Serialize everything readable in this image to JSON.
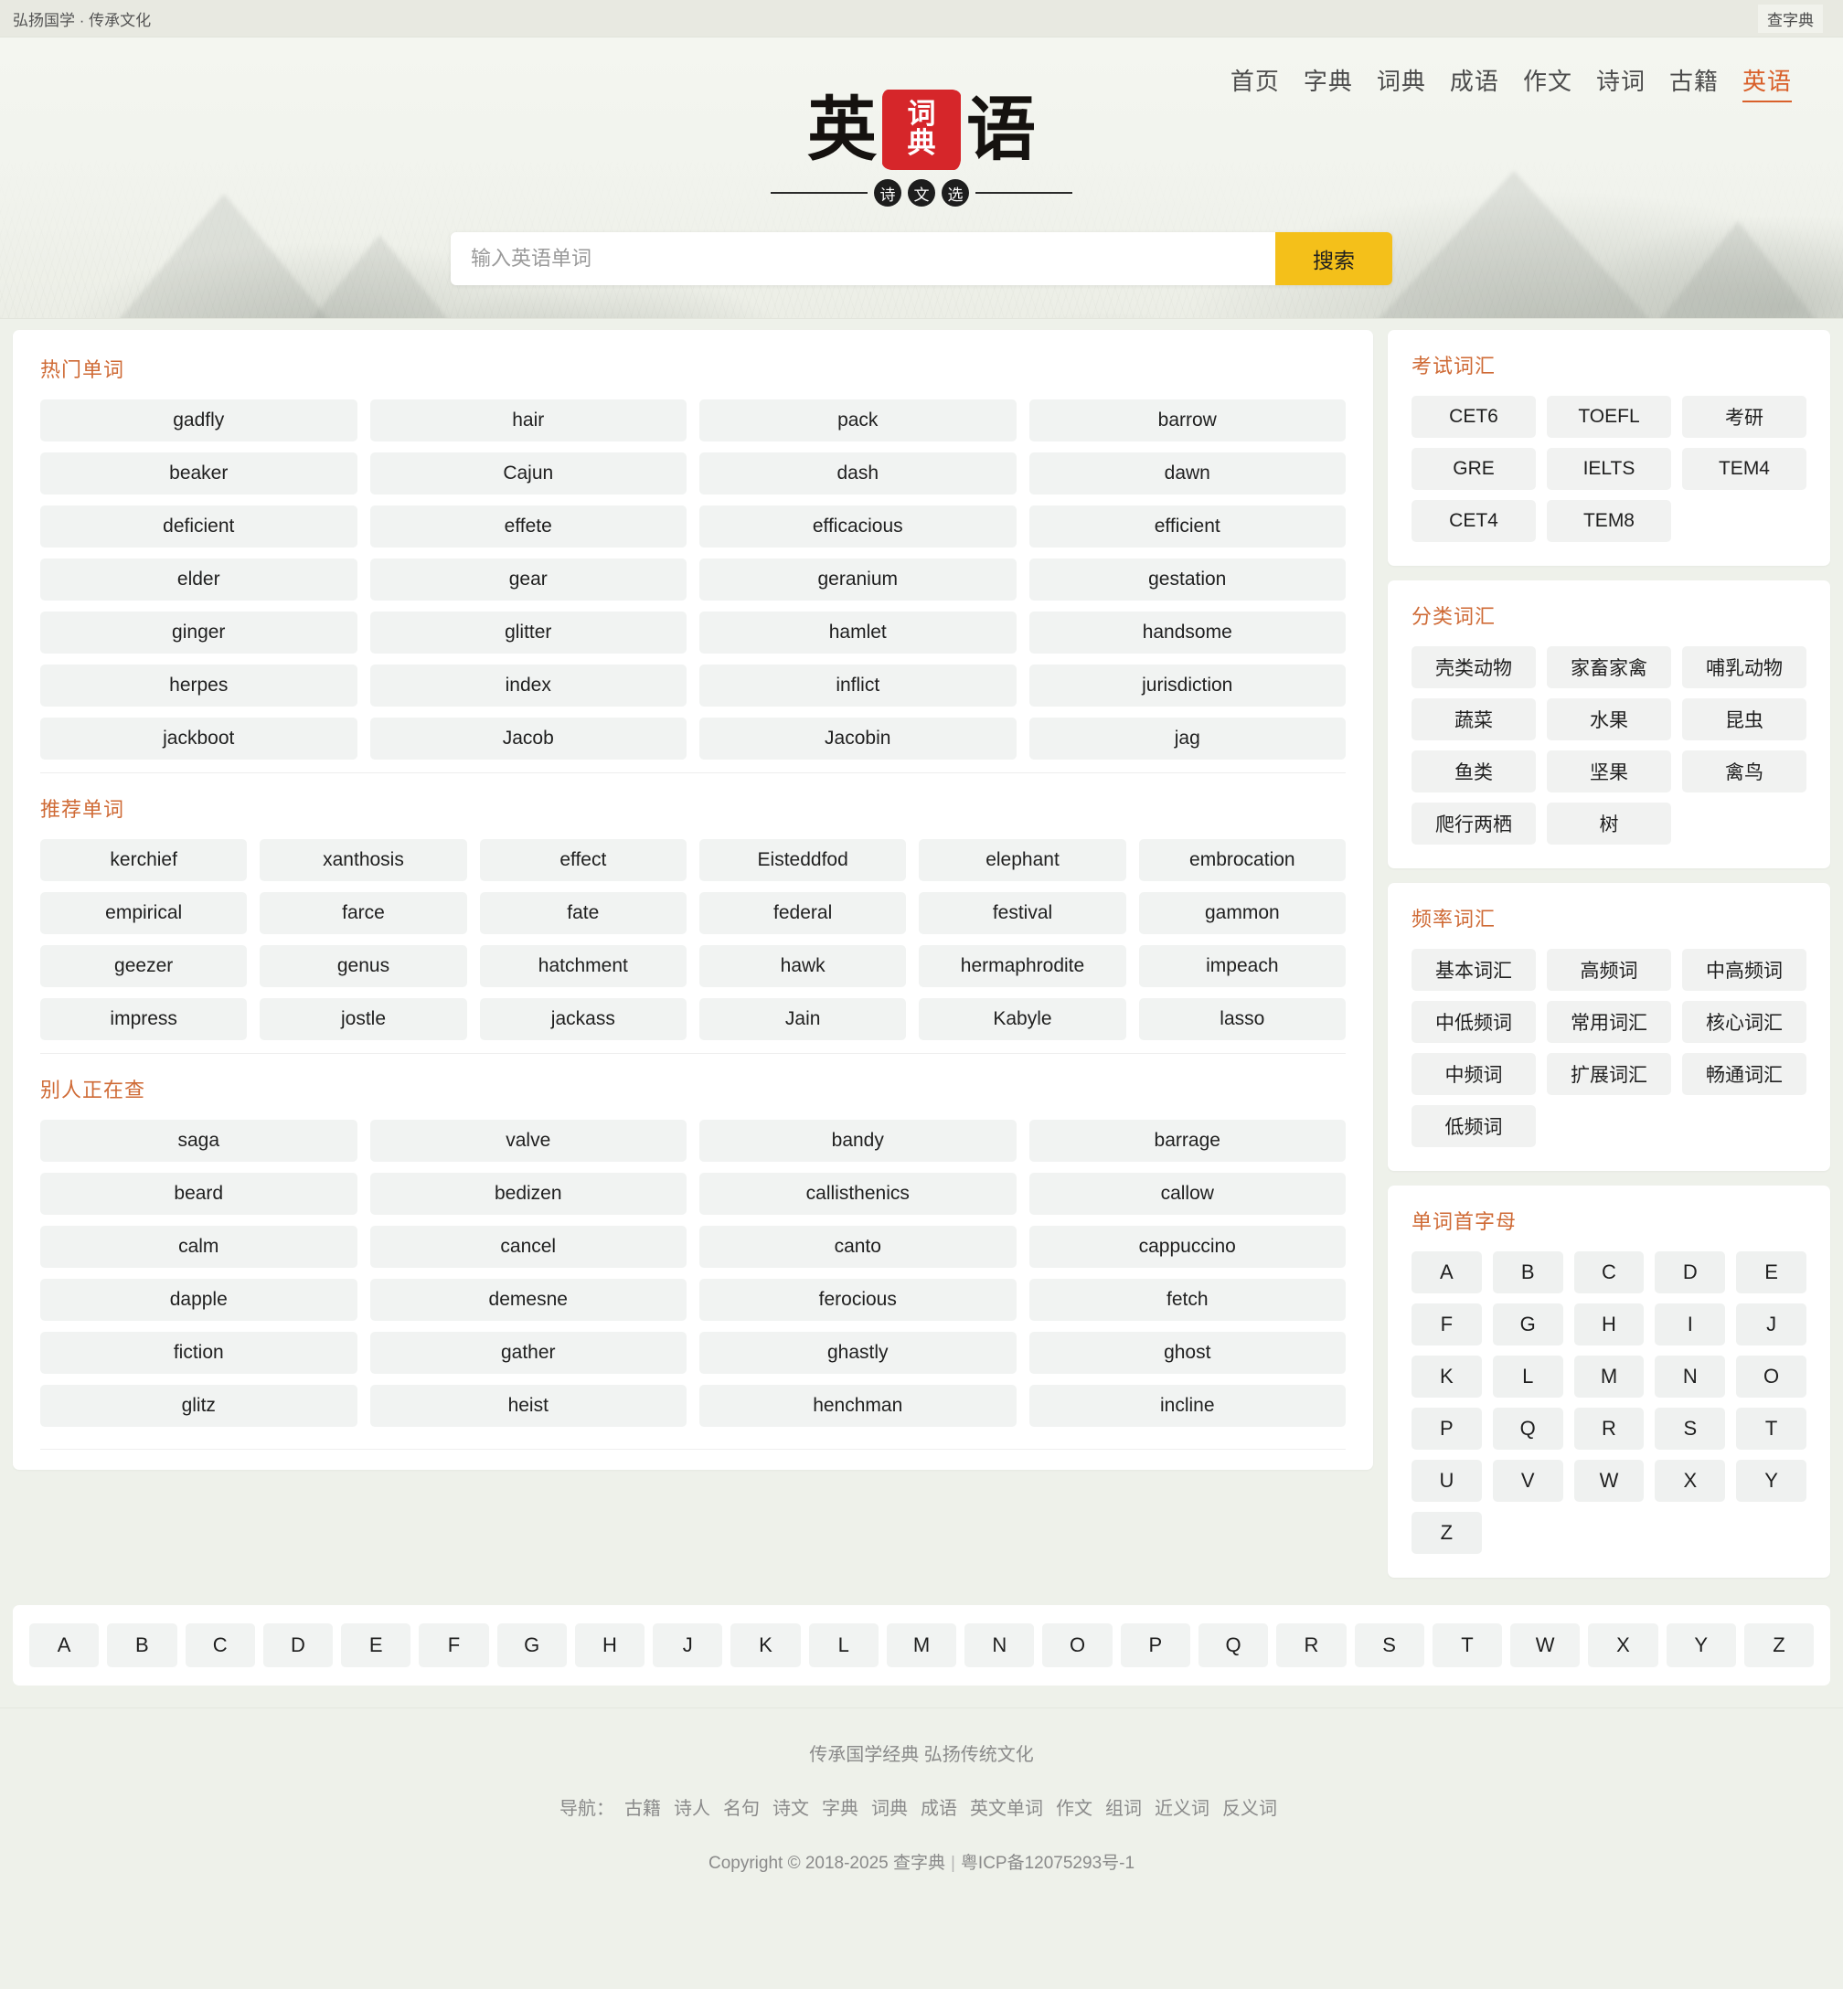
{
  "topbar": {
    "left": "弘扬国学 · 传承文化",
    "right": "查字典"
  },
  "nav": [
    {
      "label": "首页",
      "active": false
    },
    {
      "label": "字典",
      "active": false
    },
    {
      "label": "词典",
      "active": false
    },
    {
      "label": "成语",
      "active": false
    },
    {
      "label": "作文",
      "active": false
    },
    {
      "label": "诗词",
      "active": false
    },
    {
      "label": "古籍",
      "active": false
    },
    {
      "label": "英语",
      "active": true
    }
  ],
  "logo": {
    "left_char": "英",
    "seal_top": "词",
    "seal_bottom": "典",
    "right_char": "语",
    "sub_dots": [
      "诗",
      "文",
      "选"
    ]
  },
  "search": {
    "placeholder": "输入英语单词",
    "value": "",
    "button_label": "搜索"
  },
  "main": {
    "sections": [
      {
        "title": "热门单词",
        "columns": 4,
        "words": [
          "gadfly",
          "hair",
          "pack",
          "barrow",
          "beaker",
          "Cajun",
          "dash",
          "dawn",
          "deficient",
          "effete",
          "efficacious",
          "efficient",
          "elder",
          "gear",
          "geranium",
          "gestation",
          "ginger",
          "glitter",
          "hamlet",
          "handsome",
          "herpes",
          "index",
          "inflict",
          "jurisdiction",
          "jackboot",
          "Jacob",
          "Jacobin",
          "jag"
        ]
      },
      {
        "title": "推荐单词",
        "columns": 6,
        "words": [
          "kerchief",
          "xanthosis",
          "effect",
          "Eisteddfod",
          "elephant",
          "embrocation",
          "empirical",
          "farce",
          "fate",
          "federal",
          "festival",
          "gammon",
          "geezer",
          "genus",
          "hatchment",
          "hawk",
          "hermaphrodite",
          "impeach",
          "impress",
          "jostle",
          "jackass",
          "Jain",
          "Kabyle",
          "lasso"
        ]
      },
      {
        "title": "别人正在查",
        "columns": 4,
        "words": [
          "saga",
          "valve",
          "bandy",
          "barrage",
          "beard",
          "bedizen",
          "callisthenics",
          "callow",
          "calm",
          "cancel",
          "canto",
          "cappuccino",
          "dapple",
          "demesne",
          "ferocious",
          "fetch",
          "fiction",
          "gather",
          "ghastly",
          "ghost",
          "glitz",
          "heist",
          "henchman",
          "incline"
        ]
      }
    ]
  },
  "sidebar": {
    "exam": {
      "title": "考试词汇",
      "items": [
        "CET6",
        "TOEFL",
        "考研",
        "GRE",
        "IELTS",
        "TEM4",
        "CET4",
        "TEM8"
      ]
    },
    "category": {
      "title": "分类词汇",
      "items": [
        "壳类动物",
        "家畜家禽",
        "哺乳动物",
        "蔬菜",
        "水果",
        "昆虫",
        "鱼类",
        "坚果",
        "禽鸟",
        "爬行两栖",
        "树"
      ]
    },
    "frequency": {
      "title": "频率词汇",
      "items": [
        "基本词汇",
        "高频词",
        "中高频词",
        "中低频词",
        "常用词汇",
        "核心词汇",
        "中频词",
        "扩展词汇",
        "畅通词汇",
        "低频词"
      ]
    },
    "initials": {
      "title": "单词首字母",
      "items": [
        "A",
        "B",
        "C",
        "D",
        "E",
        "F",
        "G",
        "H",
        "I",
        "J",
        "K",
        "L",
        "M",
        "N",
        "O",
        "P",
        "Q",
        "R",
        "S",
        "T",
        "U",
        "V",
        "W",
        "X",
        "Y",
        "Z"
      ]
    }
  },
  "bottom_alphabet": [
    "A",
    "B",
    "C",
    "D",
    "E",
    "F",
    "G",
    "H",
    "J",
    "K",
    "L",
    "M",
    "N",
    "O",
    "P",
    "Q",
    "R",
    "S",
    "T",
    "W",
    "X",
    "Y",
    "Z"
  ],
  "footer": {
    "slogan": "传承国学经典 弘扬传统文化",
    "nav_label": "导航：",
    "nav_links": [
      "古籍",
      "诗人",
      "名句",
      "诗文",
      "字典",
      "词典",
      "成语",
      "英文单词",
      "作文",
      "组词",
      "近义词",
      "反义词"
    ],
    "copyright": "Copyright © 2018-2025 查字典",
    "icp": "粤ICP备12075293号-1"
  },
  "colors": {
    "accent_orange": "#cf6a35",
    "nav_active": "#d9602a",
    "search_button": "#f4c01a",
    "seal_red": "#d6262a",
    "page_bg": "#eef1ea",
    "chip_bg": "#f1f3f2"
  }
}
